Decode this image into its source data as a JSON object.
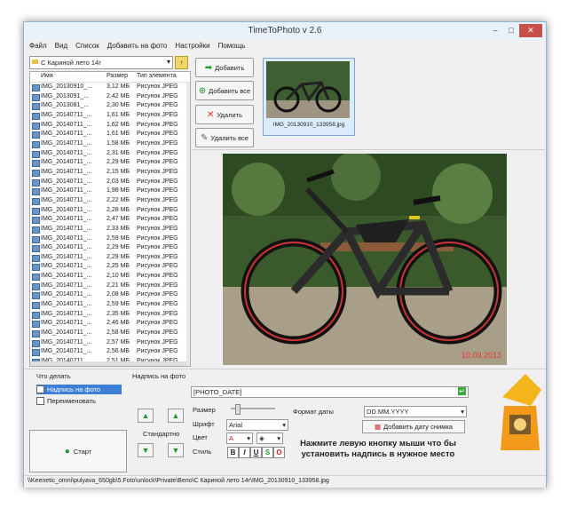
{
  "window": {
    "title": "TimeToPhoto v 2.6",
    "minimize": "–",
    "maximize": "□",
    "close": "✕"
  },
  "menu": [
    "Файл",
    "Вид",
    "Список",
    "Добавить на фото",
    "Настройки",
    "Помощь"
  ],
  "folder": {
    "value": "С Кариной лето 14г"
  },
  "filelist": {
    "headers": {
      "name": "Имя",
      "size": "Размер",
      "type": "Тип элемента"
    },
    "rows": [
      {
        "name": "IMG_20130910_...",
        "size": "3,12 МБ",
        "type": "Рисунок JPEG"
      },
      {
        "name": "IMG_2013091_...",
        "size": "2,42 МБ",
        "type": "Рисунок JPEG"
      },
      {
        "name": "IMG_2013081_...",
        "size": "2,30 МБ",
        "type": "Рисунок JPEG"
      },
      {
        "name": "IMG_20140711_...",
        "size": "1,61 МБ",
        "type": "Рисунок JPEG"
      },
      {
        "name": "IMG_20140711_...",
        "size": "1,62 МБ",
        "type": "Рисунок JPEG"
      },
      {
        "name": "IMG_20140711_...",
        "size": "1,61 МБ",
        "type": "Рисунок JPEG"
      },
      {
        "name": "IMG_20140711_...",
        "size": "1,58 МБ",
        "type": "Рисунок JPEG"
      },
      {
        "name": "IMG_20140711_...",
        "size": "2,31 МБ",
        "type": "Рисунок JPEG"
      },
      {
        "name": "IMG_20140711_...",
        "size": "2,29 МБ",
        "type": "Рисунок JPEG"
      },
      {
        "name": "IMG_20140711_...",
        "size": "2,15 МБ",
        "type": "Рисунок JPEG"
      },
      {
        "name": "IMG_20140711_...",
        "size": "2,03 МБ",
        "type": "Рисунок JPEG"
      },
      {
        "name": "IMG_20140711_...",
        "size": "1,98 МБ",
        "type": "Рисунок JPEG"
      },
      {
        "name": "IMG_20140711_...",
        "size": "2,22 МБ",
        "type": "Рисунок JPEG"
      },
      {
        "name": "IMG_20140711_...",
        "size": "2,28 МБ",
        "type": "Рисунок JPEG"
      },
      {
        "name": "IMG_20140711_...",
        "size": "2,47 МБ",
        "type": "Рисунок JPEG"
      },
      {
        "name": "IMG_20140711_...",
        "size": "2,33 МБ",
        "type": "Рисунок JPEG"
      },
      {
        "name": "IMG_20140711_...",
        "size": "2,59 МБ",
        "type": "Рисунок JPEG"
      },
      {
        "name": "IMG_20140711_...",
        "size": "2,29 МБ",
        "type": "Рисунок JPEG"
      },
      {
        "name": "IMG_20140711_...",
        "size": "2,29 МБ",
        "type": "Рисунок JPEG"
      },
      {
        "name": "IMG_20140711_...",
        "size": "2,25 МБ",
        "type": "Рисунок JPEG"
      },
      {
        "name": "IMG_20140711_...",
        "size": "2,10 МБ",
        "type": "Рисунок JPEG"
      },
      {
        "name": "IMG_20140711_...",
        "size": "2,21 МБ",
        "type": "Рисунок JPEG"
      },
      {
        "name": "IMG_20140711_...",
        "size": "2,08 МБ",
        "type": "Рисунок JPEG"
      },
      {
        "name": "IMG_20140711_...",
        "size": "2,59 МБ",
        "type": "Рисунок JPEG"
      },
      {
        "name": "IMG_20140711_...",
        "size": "2,35 МБ",
        "type": "Рисунок JPEG"
      },
      {
        "name": "IMG_20140711_...",
        "size": "2,46 МБ",
        "type": "Рисунок JPEG"
      },
      {
        "name": "IMG_20140711_...",
        "size": "2,58 МБ",
        "type": "Рисунок JPEG"
      },
      {
        "name": "IMG_20140711_...",
        "size": "2,57 МБ",
        "type": "Рисунок JPEG"
      },
      {
        "name": "IMG_20140711_...",
        "size": "2,56 МБ",
        "type": "Рисунок JPEG"
      },
      {
        "name": "IMG_20140711_...",
        "size": "2,51 МБ",
        "type": "Рисунок JPEG"
      }
    ]
  },
  "buttons": {
    "add": "Добавить",
    "add_all": "Добавить все",
    "remove": "Удалить",
    "remove_all": "Удалить все"
  },
  "thumbnail": {
    "caption": "IMG_20130910_133958.jpg"
  },
  "preview": {
    "date_stamp": "10.09.2013"
  },
  "actions": {
    "title": "Что делать",
    "opt1": "Надпись на фото",
    "opt1_checked": "✓",
    "opt2": "Переименовать",
    "start": "Старт"
  },
  "caption_panel": {
    "title": "Надпись на фото",
    "standard": "Стандартно",
    "text_value": "[PHOTO_DATE]"
  },
  "format": {
    "size_label": "Размер",
    "font_label": "Шрифт",
    "font_value": "Arial",
    "color_label": "Цвет",
    "style_label": "Стиль",
    "styles": [
      "B",
      "I",
      "U",
      "S",
      "O"
    ],
    "date_format_label": "Формат даты",
    "date_format_value": "DD.MM.YYYY",
    "add_date": "Добавить дату снимка",
    "hint": "Нажмите левую кнопку мыши что бы установить надпись в нужное место"
  },
  "statusbar": {
    "path": "\\\\Keenetic_omni\\pulyava_650gb\\5.Foto\\unlock\\Private\\Вело\\С Кариной лето 14г\\IMG_20130910_133958.jpg"
  },
  "colors": {
    "accent": "#3d7fd6",
    "green": "#1e9b2b",
    "date_red": "#e83434"
  }
}
